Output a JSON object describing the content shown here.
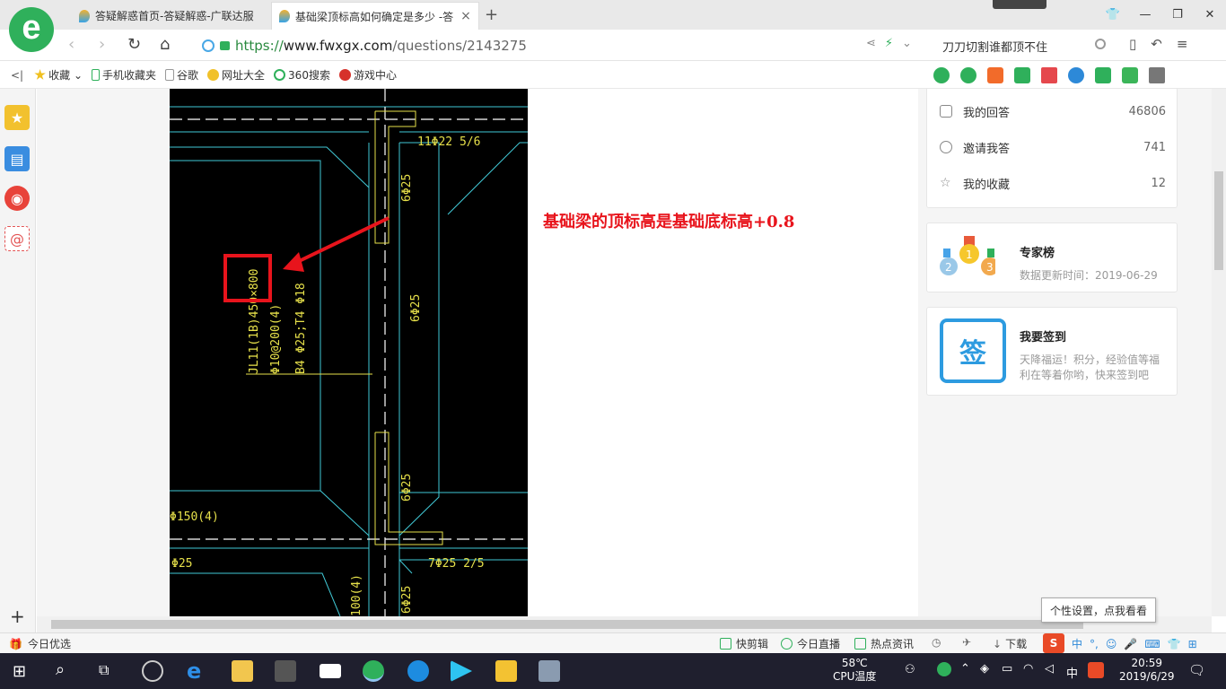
{
  "tabs": [
    {
      "label": "答疑解惑首页-答疑解惑-广联达服"
    },
    {
      "label": "基础梁顶标高如何确定是多少 -答"
    }
  ],
  "address": {
    "protocol": "https://",
    "host": "www.fwxgx.com",
    "path": "/questions/2143275"
  },
  "search": {
    "value": "刀刀切割谁都顶不住"
  },
  "bookmarks": [
    {
      "label": "收藏"
    },
    {
      "label": "手机收藏夹"
    },
    {
      "label": "谷歌"
    },
    {
      "label": "网址大全"
    },
    {
      "label": "360搜索"
    },
    {
      "label": "游戏中心"
    }
  ],
  "cad": {
    "labels": [
      "11Φ22 5/6",
      "6Φ25",
      "6Φ25",
      "6Φ25",
      "6Φ25",
      "JL11(1B)450×800",
      "Φ10@200(4)",
      "B4 Φ25;T4 Φ18",
      "Φ150(4)",
      "Φ25",
      "7Φ25 2/5",
      "100(4)"
    ]
  },
  "annotation": {
    "text": "基础梁的顶标高是基础底标高+0.8"
  },
  "user_stats": [
    {
      "label": "我的回答",
      "value": "46806"
    },
    {
      "label": "邀请我答",
      "value": "741"
    },
    {
      "label": "我的收藏",
      "value": "12"
    }
  ],
  "expert": {
    "title": "专家榜",
    "update_label": "数据更新时间：2019-06-29"
  },
  "signin": {
    "title": "我要签到",
    "badge": "签",
    "desc_line1": "天降福运！积分，经验值等福",
    "desc_line2": "利在等着你哟，快来签到吧"
  },
  "statusbar": {
    "today_pick": "今日优选",
    "items": [
      {
        "label": "快剪辑"
      },
      {
        "label": "今日直播"
      },
      {
        "label": "热点资讯"
      },
      {
        "label": "下载"
      }
    ],
    "tooltip": "个性设置，点我看看"
  },
  "taskbar": {
    "temp": "58℃",
    "temp_label": "CPU温度",
    "ime": "中",
    "time": "20:59",
    "date": "2019/6/29"
  },
  "colors": {
    "accent_green": "#2fb05b",
    "annotation_red": "#e8141c",
    "cad_cyan": "#41c9d6",
    "cad_yellow": "#e6e04a"
  }
}
